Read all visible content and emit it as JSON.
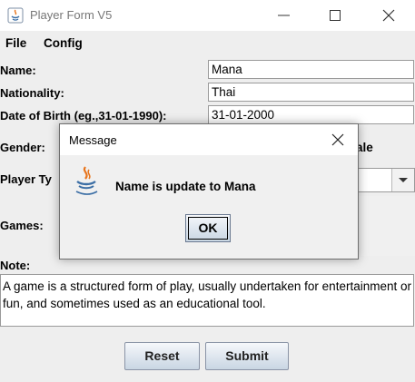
{
  "window": {
    "title": "Player Form V5",
    "icon": "java-icon",
    "controls": [
      "minimize-icon",
      "maximize-icon",
      "close-icon"
    ]
  },
  "menubar": {
    "file": "File",
    "config": "Config"
  },
  "form": {
    "name_label": "Name:",
    "name_value": "Mana",
    "nationality_label": "Nationality:",
    "nationality_value": "Thai",
    "dob_label": "Date of Birth (eg.,31-01-1990):",
    "dob_value": "31-01-2000",
    "gender_label": "Gender:",
    "gender_option_visible": "ale",
    "player_type_label": "Player Ty",
    "player_type_value": "",
    "games_label": "Games:",
    "note_label": "Note:",
    "note_value": "A game is a structured form of play, usually undertaken for entertainment or fun, and sometimes used as an educational tool.",
    "reset_label": "Reset",
    "submit_label": "Submit"
  },
  "dialog": {
    "title": "Message",
    "message": "Name is update to Mana",
    "ok_label": "OK",
    "icon": "java-icon"
  },
  "colors": {
    "window_bg": "#eeeeee",
    "titlebar_bg": "#ffffff",
    "field_border": "#9a9a9a",
    "button_gradient_top": "#f6f8fb",
    "button_gradient_bottom": "#c9d6e3"
  }
}
